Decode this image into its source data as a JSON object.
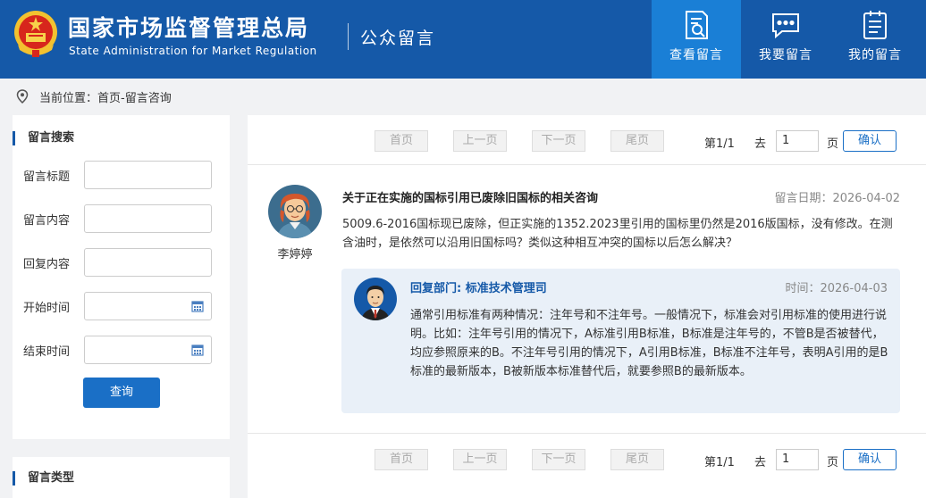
{
  "header": {
    "title_cn": "国家市场监督管理总局",
    "title_en": "State Administration for Market Regulation",
    "subtitle": "公众留言",
    "brand_color": "#1559a8",
    "active_color": "#1a7fd6",
    "nav": [
      {
        "label": "查看留言",
        "icon": "search-document-icon",
        "active": true
      },
      {
        "label": "我要留言",
        "icon": "chat-bubble-icon",
        "active": false
      },
      {
        "label": "我的留言",
        "icon": "list-document-icon",
        "active": false
      }
    ]
  },
  "breadcrumb": {
    "icon": "location-pin-icon",
    "text": "当前位置：首页-留言咨询"
  },
  "sidebar": {
    "search": {
      "title": "留言搜索",
      "fields": [
        {
          "label": "留言标题",
          "value": ""
        },
        {
          "label": "留言内容",
          "value": ""
        },
        {
          "label": "回复内容",
          "value": ""
        },
        {
          "label": "开始时间",
          "value": "",
          "icon": "calendar-icon"
        },
        {
          "label": "结束时间",
          "value": "",
          "icon": "calendar-icon"
        }
      ],
      "button": "查询"
    },
    "types": {
      "title": "留言类型"
    }
  },
  "pager": {
    "first": "首页",
    "prev": "上一页",
    "next": "下一页",
    "last": "尾页",
    "page_info": "第1/1",
    "go_label": "去",
    "page_input": "1",
    "page_unit": "页",
    "confirm": "确认"
  },
  "message": {
    "title": "关于正在实施的国标引用已废除旧国标的相关咨询",
    "date_label": "留言日期：2026-04-02",
    "author": "李婷婷",
    "body": "5009.6-2016国标现已废除，但正实施的1352.2023里引用的国标里仍然是2016版国标，没有修改。在测含油时，是依然可以沿用旧国标吗？类似这种相互冲突的国标以后怎么解决？",
    "reply": {
      "dept": "回复部门: 标准技术管理司",
      "date": "时间：2026-04-03",
      "body": "通常引用标准有两种情况：注年号和不注年号。一般情况下，标准会对引用标准的使用进行说明。比如：注年号引用的情况下，A标准引用B标准，B标准是注年号的，不管B是否被替代，均应参照原来的B。不注年号引用的情况下，A引用B标准，B标准不注年号，表明A引用的是B标准的最新版本，B被新版本标准替代后，就要参照B的最新版本。"
    }
  }
}
